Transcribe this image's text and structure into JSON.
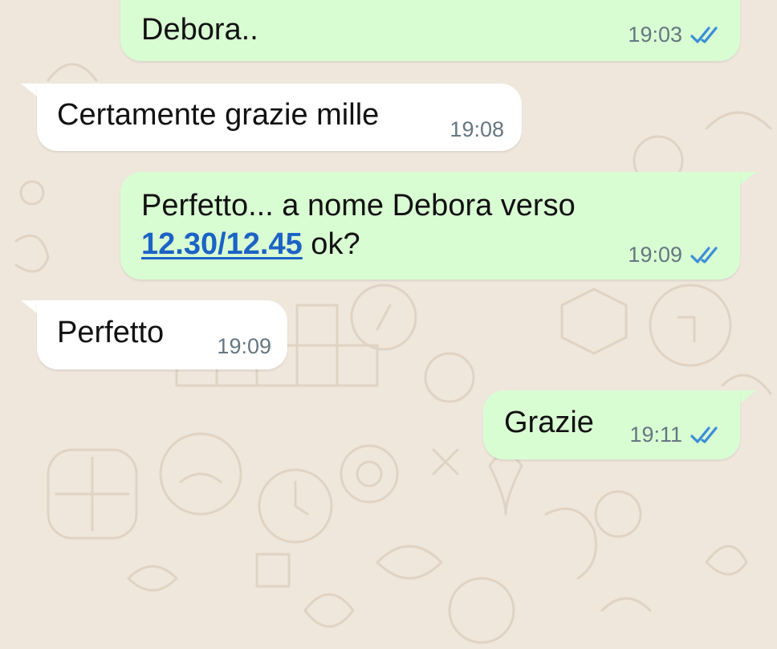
{
  "messages": [
    {
      "direction": "outgoing",
      "text": "Debora..",
      "time": "19:03",
      "status": "read"
    },
    {
      "direction": "incoming",
      "text": "Certamente grazie mille",
      "time": "19:08"
    },
    {
      "direction": "outgoing",
      "line1": "Perfetto... a nome Debora verso",
      "link": "12.30/12.45",
      "line2_suffix": " ok?",
      "time": "19:09",
      "status": "read"
    },
    {
      "direction": "incoming",
      "text": "Perfetto",
      "time": "19:09"
    },
    {
      "direction": "outgoing",
      "text": "Grazie",
      "time": "19:11",
      "status": "read"
    }
  ],
  "colors": {
    "wallpaper": "#efe7dc",
    "outgoing_bubble": "#d9fdd3",
    "incoming_bubble": "#ffffff",
    "read_tick": "#3b8ed8",
    "link": "#1b63c5"
  },
  "icons": {
    "read_receipt": "double-check-icon"
  }
}
